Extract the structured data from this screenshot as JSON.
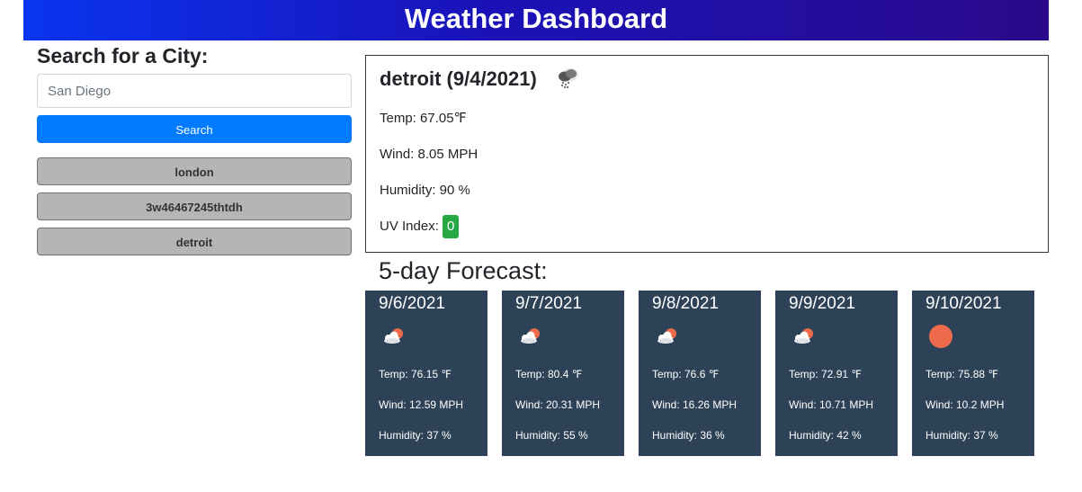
{
  "header": {
    "title": "Weather Dashboard"
  },
  "search": {
    "heading": "Search for a City:",
    "placeholder": "San Diego",
    "button_label": "Search",
    "history": [
      "london",
      "3w46467245thtdh",
      "detroit"
    ]
  },
  "current": {
    "title": "detroit (9/4/2021)",
    "icon": "cloud-rain-icon",
    "temp": "Temp: 67.05℉",
    "wind": "Wind: 8.05 MPH",
    "humidity": "Humidity: 90 %",
    "uv_label": "UV Index:",
    "uv_value": "0",
    "uv_color": "#28a745"
  },
  "forecast": {
    "heading": "5-day Forecast:",
    "days": [
      {
        "date": "9/6/2021",
        "icon": "partly-cloudy-icon",
        "temp": "Temp: 76.15 ℉",
        "wind": "Wind: 12.59 MPH",
        "humidity": "Humidity: 37 %"
      },
      {
        "date": "9/7/2021",
        "icon": "partly-cloudy-icon",
        "temp": "Temp: 80.4 ℉",
        "wind": "Wind: 20.31 MPH",
        "humidity": "Humidity: 55 %"
      },
      {
        "date": "9/8/2021",
        "icon": "partly-cloudy-icon",
        "temp": "Temp: 76.6 ℉",
        "wind": "Wind: 16.26 MPH",
        "humidity": "Humidity: 36 %"
      },
      {
        "date": "9/9/2021",
        "icon": "partly-cloudy-icon",
        "temp": "Temp: 72.91 ℉",
        "wind": "Wind: 10.71 MPH",
        "humidity": "Humidity: 42 %"
      },
      {
        "date": "9/10/2021",
        "icon": "sun-icon",
        "temp": "Temp: 75.88 ℉",
        "wind": "Wind: 10.2 MPH",
        "humidity": "Humidity: 37 %"
      }
    ]
  },
  "colors": {
    "header_gradient_start": "#0a35f0",
    "header_gradient_end": "#2a0a8a",
    "search_button": "#007bff",
    "history_button": "#b5b5b5",
    "forecast_card": "#2e4257",
    "sun": "#ee6a4c"
  }
}
